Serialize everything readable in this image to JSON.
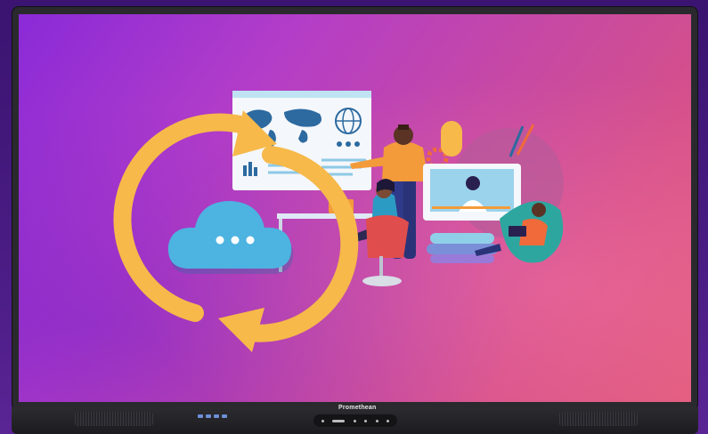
{
  "device": {
    "brand_label": "Promethean"
  },
  "illustration": {
    "sync_icon": "sync-arrows-icon",
    "cloud_icon": "cloud-icon",
    "cloud_dots": "•••",
    "colors": {
      "sync_orange": "#f6b94a",
      "cloud_blue": "#4db3e0",
      "screen_purple": "#8a2ad8",
      "screen_pink": "#e05a7a"
    }
  }
}
